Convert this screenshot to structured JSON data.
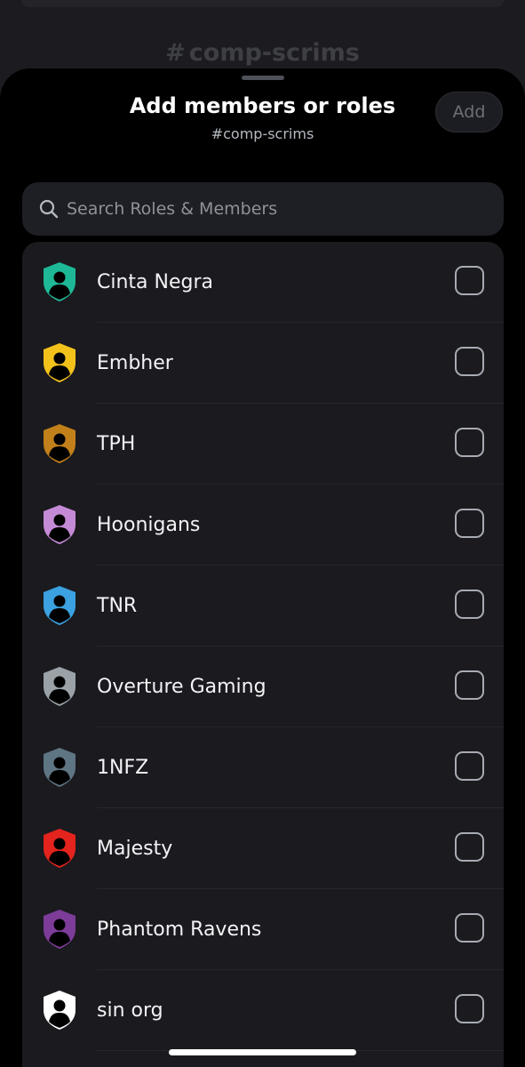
{
  "background": {
    "channel_hash": "#",
    "channel_name": "comp-scrims"
  },
  "header": {
    "title": "Add members or roles",
    "subtitle": "#comp-scrims",
    "add_label": "Add"
  },
  "search": {
    "placeholder": "Search Roles & Members"
  },
  "roles": [
    {
      "name": "Cinta Negra",
      "color": "#1fb896",
      "checked": false
    },
    {
      "name": "Embher",
      "color": "#f2c21b",
      "checked": false
    },
    {
      "name": "TPH",
      "color": "#c2801a",
      "checked": false
    },
    {
      "name": "Hoonigans",
      "color": "#c58ad6",
      "checked": false
    },
    {
      "name": "TNR",
      "color": "#3ba1e0",
      "checked": false
    },
    {
      "name": "Overture Gaming",
      "color": "#9aa2a8",
      "checked": false
    },
    {
      "name": "1NFZ",
      "color": "#5e7583",
      "checked": false
    },
    {
      "name": "Majesty",
      "color": "#e3231d",
      "checked": false
    },
    {
      "name": "Phantom Ravens",
      "color": "#7d3c98",
      "checked": false
    },
    {
      "name": "sin org",
      "color": "#ffffff",
      "checked": false
    }
  ]
}
